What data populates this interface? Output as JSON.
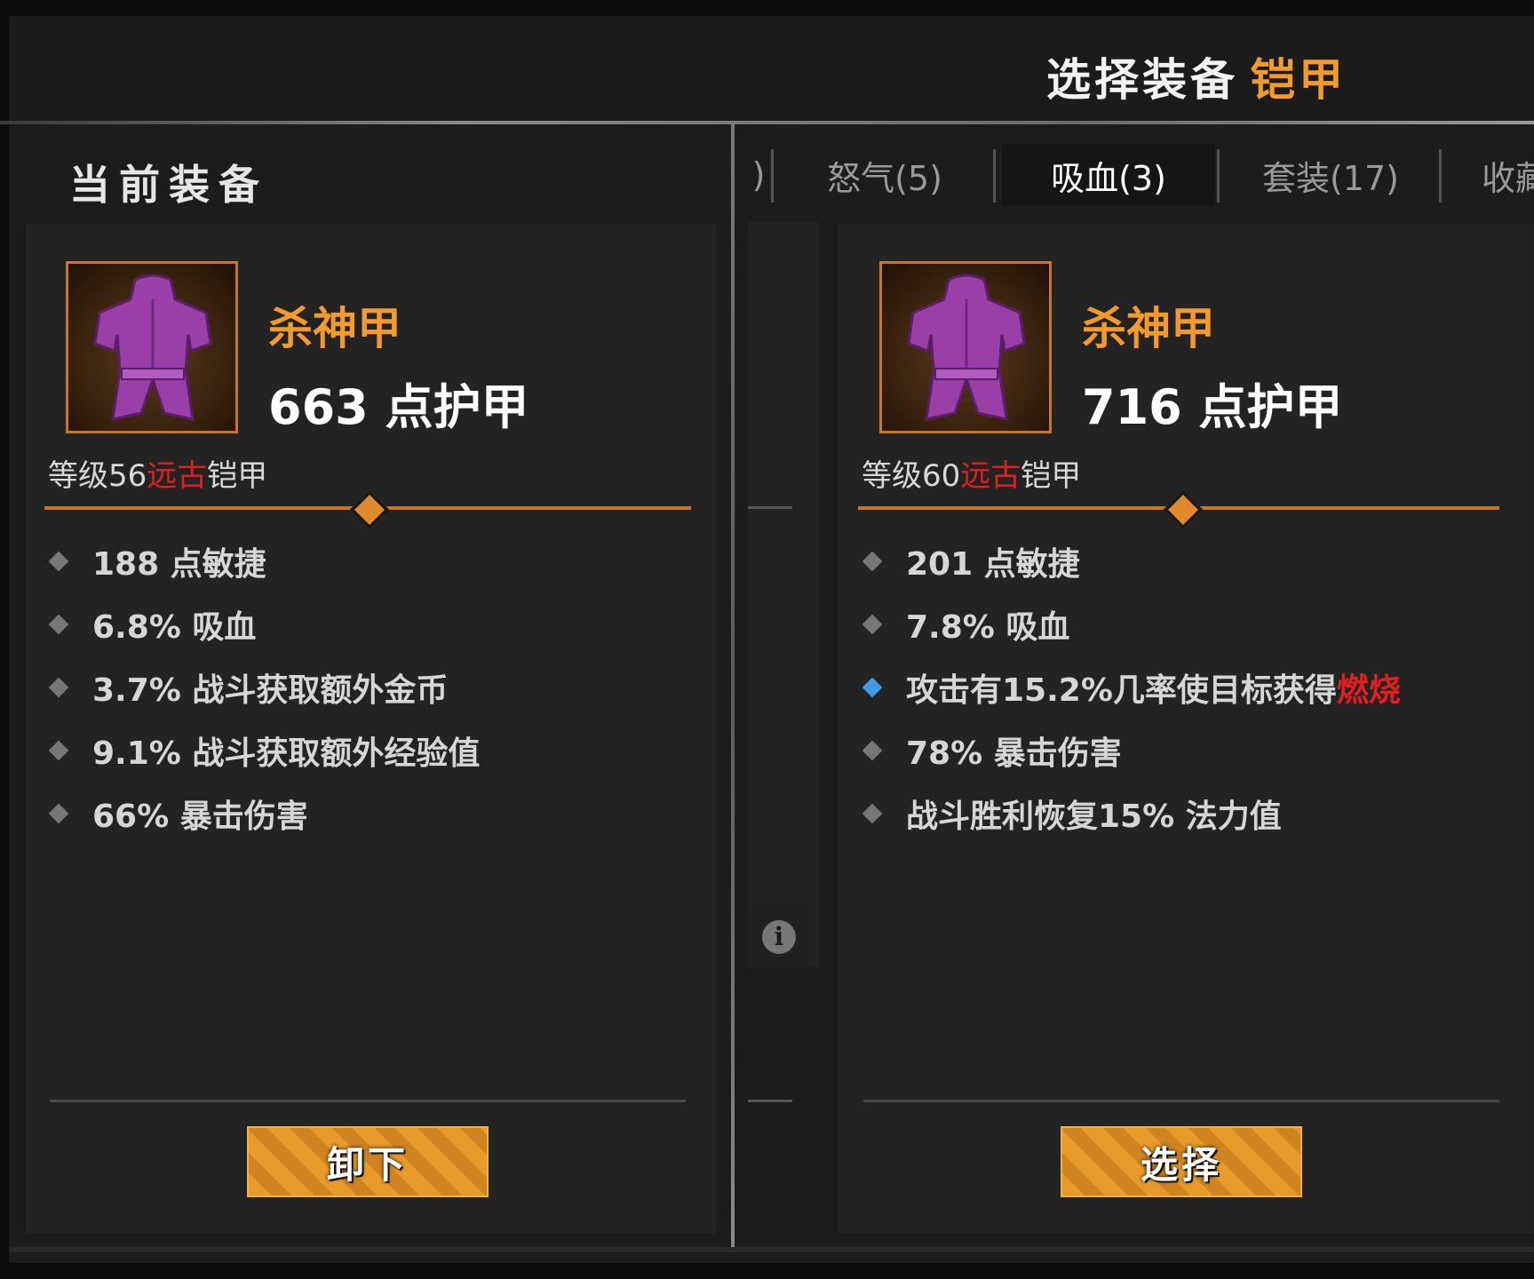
{
  "header": {
    "title": "选择装备",
    "title_accent": "铠甲"
  },
  "current": {
    "section_label": "当前装备",
    "item": {
      "name": "杀神甲",
      "armor": "663 点护甲",
      "level_prefix": "等级56",
      "rarity": "远古",
      "type": "铠甲",
      "stats": [
        {
          "text": "188 点敏捷"
        },
        {
          "text": "6.8% 吸血"
        },
        {
          "text": "3.7% 战斗获取额外金币"
        },
        {
          "text": "9.1% 战斗获取额外经验值"
        },
        {
          "text": "66% 暴击伤害"
        }
      ]
    },
    "button_label": "卸下"
  },
  "tabs": [
    {
      "label": ")"
    },
    {
      "label": "怒气(5)"
    },
    {
      "label": "吸血(3)",
      "active": true
    },
    {
      "label": "套装(17)"
    },
    {
      "label": "收藏"
    }
  ],
  "candidate": {
    "item": {
      "name": "杀神甲",
      "armor": "716 点护甲",
      "level_prefix": "等级60",
      "rarity": "远古",
      "type": "铠甲",
      "stats": [
        {
          "text": "201 点敏捷"
        },
        {
          "text": "7.8% 吸血"
        },
        {
          "text_prefix": "攻击有15.2%几率使目标获得",
          "text_red": "燃烧",
          "special": true
        },
        {
          "text": "78% 暴击伤害"
        },
        {
          "text": "战斗胜利恢复15% 法力值"
        }
      ]
    },
    "button_label": "选择"
  },
  "info_icon": "i",
  "colors": {
    "accent_orange": "#f29a2e",
    "rarity_red": "#e02020",
    "special_bullet_blue": "#3d9ae8",
    "item_icon": "purple-armor-icon"
  }
}
